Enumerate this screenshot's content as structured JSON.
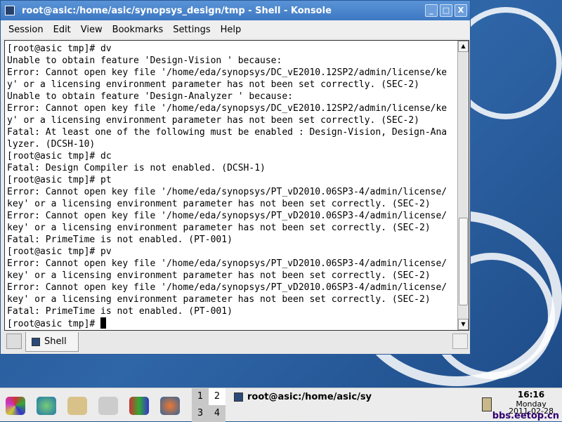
{
  "window": {
    "title": "root@asic:/home/asic/synopsys_design/tmp - Shell - Konsole",
    "buttons": [
      "_",
      "□",
      "X"
    ]
  },
  "menu": [
    "Session",
    "Edit",
    "View",
    "Bookmarks",
    "Settings",
    "Help"
  ],
  "terminal": {
    "lines": [
      "[root@asic tmp]# dv",
      "Unable to obtain feature 'Design-Vision ' because:",
      "Error: Cannot open key file '/home/eda/synopsys/DC_vE2010.12SP2/admin/license/ke",
      "y' or a licensing environment parameter has not been set correctly. (SEC-2)",
      "Unable to obtain feature 'Design-Analyzer ' because:",
      "Error: Cannot open key file '/home/eda/synopsys/DC_vE2010.12SP2/admin/license/ke",
      "y' or a licensing environment parameter has not been set correctly. (SEC-2)",
      "Fatal: At least one of the following must be enabled : Design-Vision, Design-Ana",
      "lyzer. (DCSH-10)",
      "[root@asic tmp]# dc",
      "Fatal: Design Compiler is not enabled. (DCSH-1)",
      "[root@asic tmp]# pt",
      "Error: Cannot open key file '/home/eda/synopsys/PT_vD2010.06SP3-4/admin/license/",
      "key' or a licensing environment parameter has not been set correctly. (SEC-2)",
      "Error: Cannot open key file '/home/eda/synopsys/PT_vD2010.06SP3-4/admin/license/",
      "key' or a licensing environment parameter has not been set correctly. (SEC-2)",
      "Fatal: PrimeTime is not enabled. (PT-001)",
      "[root@asic tmp]# pv",
      "Error: Cannot open key file '/home/eda/synopsys/PT_vD2010.06SP3-4/admin/license/",
      "key' or a licensing environment parameter has not been set correctly. (SEC-2)",
      "Error: Cannot open key file '/home/eda/synopsys/PT_vD2010.06SP3-4/admin/license/",
      "key' or a licensing environment parameter has not been set correctly. (SEC-2)",
      "Fatal: PrimeTime is not enabled. (PT-001)"
    ],
    "prompt": "[root@asic tmp]# "
  },
  "tabs": [
    {
      "label": "Shell"
    }
  ],
  "taskbar": {
    "pager": [
      "1",
      "2",
      "3",
      "4"
    ],
    "active_task": "root@asic:/home/asic/sy",
    "clock_time": "16:16",
    "clock_day": "Monday",
    "clock_date": "2011-02-28",
    "watermark": "bbs.eetop.cn"
  }
}
